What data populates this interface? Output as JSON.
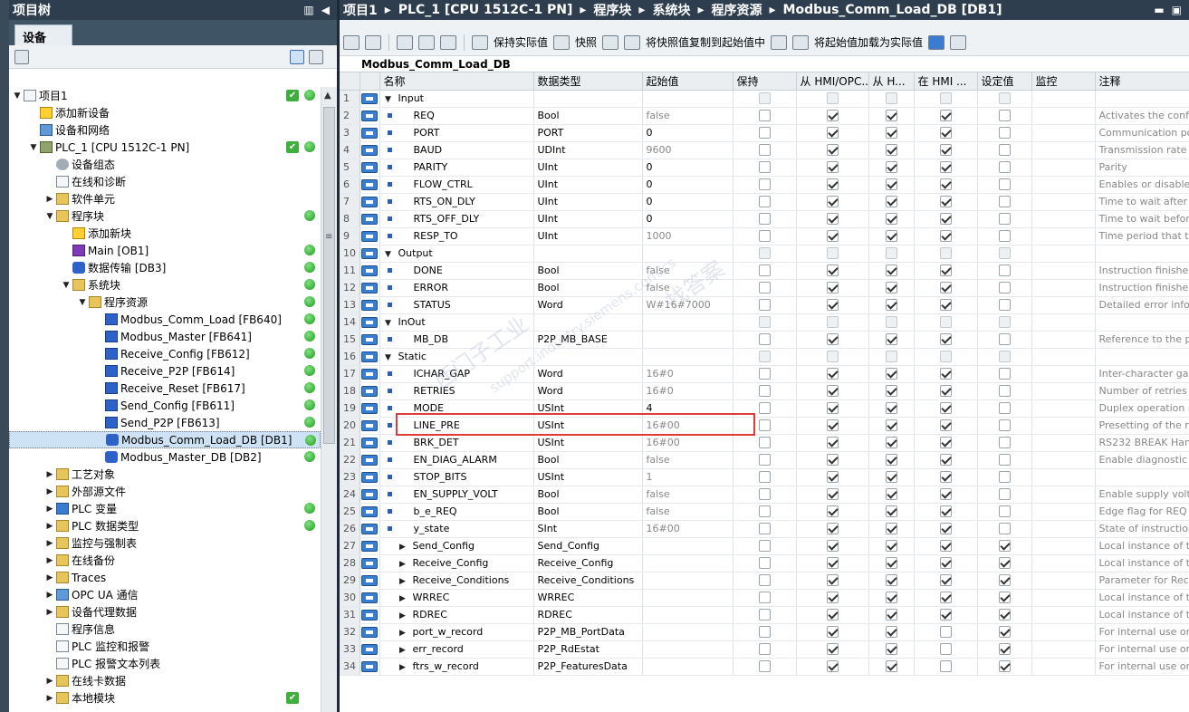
{
  "project_tree": {
    "title": "项目树",
    "tab": "设备",
    "items": [
      {
        "label": "项目1",
        "level": 0,
        "toggle": "▼",
        "icon": "doc",
        "status": "check",
        "dot": true
      },
      {
        "label": "添加新设备",
        "level": 1,
        "toggle": "",
        "icon": "add",
        "status": "",
        "dot": false
      },
      {
        "label": "设备和网络",
        "level": 1,
        "toggle": "",
        "icon": "net",
        "status": "",
        "dot": false
      },
      {
        "label": "PLC_1 [CPU 1512C-1 PN]",
        "level": 1,
        "toggle": "▼",
        "icon": "cpu",
        "status": "check",
        "dot": true
      },
      {
        "label": "设备组态",
        "level": 2,
        "toggle": "",
        "icon": "gear",
        "status": "",
        "dot": false
      },
      {
        "label": "在线和诊断",
        "level": 2,
        "toggle": "",
        "icon": "doc",
        "status": "",
        "dot": false
      },
      {
        "label": "软件单元",
        "level": 2,
        "toggle": "▶",
        "icon": "folder",
        "status": "",
        "dot": false
      },
      {
        "label": "程序块",
        "level": 2,
        "toggle": "▼",
        "icon": "folder",
        "status": "",
        "dot": true
      },
      {
        "label": "添加新块",
        "level": 3,
        "toggle": "",
        "icon": "add",
        "status": "",
        "dot": false
      },
      {
        "label": "Main [OB1]",
        "level": 3,
        "toggle": "",
        "icon": "ob",
        "status": "",
        "dot": true
      },
      {
        "label": "数据传输 [DB3]",
        "level": 3,
        "toggle": "",
        "icon": "db",
        "status": "",
        "dot": true
      },
      {
        "label": "系统块",
        "level": 3,
        "toggle": "▼",
        "icon": "folder",
        "status": "",
        "dot": true
      },
      {
        "label": "程序资源",
        "level": 4,
        "toggle": "▼",
        "icon": "folder",
        "status": "",
        "dot": true
      },
      {
        "label": "Modbus_Comm_Load [FB640]",
        "level": 5,
        "toggle": "",
        "icon": "block",
        "status": "",
        "dot": true
      },
      {
        "label": "Modbus_Master [FB641]",
        "level": 5,
        "toggle": "",
        "icon": "block",
        "status": "",
        "dot": true
      },
      {
        "label": "Receive_Config [FB612]",
        "level": 5,
        "toggle": "",
        "icon": "block",
        "status": "",
        "dot": true
      },
      {
        "label": "Receive_P2P [FB614]",
        "level": 5,
        "toggle": "",
        "icon": "block",
        "status": "",
        "dot": true
      },
      {
        "label": "Receive_Reset [FB617]",
        "level": 5,
        "toggle": "",
        "icon": "block",
        "status": "",
        "dot": true
      },
      {
        "label": "Send_Config [FB611]",
        "level": 5,
        "toggle": "",
        "icon": "block",
        "status": "",
        "dot": true
      },
      {
        "label": "Send_P2P [FB613]",
        "level": 5,
        "toggle": "",
        "icon": "block",
        "status": "",
        "dot": true
      },
      {
        "label": "Modbus_Comm_Load_DB [DB1]",
        "level": 5,
        "toggle": "",
        "icon": "db",
        "status": "",
        "dot": true,
        "selected": true
      },
      {
        "label": "Modbus_Master_DB [DB2]",
        "level": 5,
        "toggle": "",
        "icon": "db",
        "status": "",
        "dot": true
      },
      {
        "label": "工艺对象",
        "level": 2,
        "toggle": "▶",
        "icon": "folder",
        "status": "",
        "dot": false
      },
      {
        "label": "外部源文件",
        "level": 2,
        "toggle": "▶",
        "icon": "folder",
        "status": "",
        "dot": false
      },
      {
        "label": "PLC 变量",
        "level": 2,
        "toggle": "▶",
        "icon": "blue",
        "status": "",
        "dot": true
      },
      {
        "label": "PLC 数据类型",
        "level": 2,
        "toggle": "▶",
        "icon": "folder",
        "status": "",
        "dot": true
      },
      {
        "label": "监控与强制表",
        "level": 2,
        "toggle": "▶",
        "icon": "folder",
        "status": "",
        "dot": false
      },
      {
        "label": "在线备份",
        "level": 2,
        "toggle": "▶",
        "icon": "folder",
        "status": "",
        "dot": false
      },
      {
        "label": "Traces",
        "level": 2,
        "toggle": "▶",
        "icon": "folder",
        "status": "",
        "dot": false
      },
      {
        "label": "OPC UA 通信",
        "level": 2,
        "toggle": "▶",
        "icon": "net",
        "status": "",
        "dot": false
      },
      {
        "label": "设备代理数据",
        "level": 2,
        "toggle": "▶",
        "icon": "folder",
        "status": "",
        "dot": false
      },
      {
        "label": "程序信息",
        "level": 2,
        "toggle": "",
        "icon": "doc",
        "status": "",
        "dot": false
      },
      {
        "label": "PLC 监控和报警",
        "level": 2,
        "toggle": "",
        "icon": "doc",
        "status": "",
        "dot": false
      },
      {
        "label": "PLC 报警文本列表",
        "level": 2,
        "toggle": "",
        "icon": "doc",
        "status": "",
        "dot": false
      },
      {
        "label": "在线卡数据",
        "level": 2,
        "toggle": "▶",
        "icon": "folder",
        "status": "",
        "dot": false
      },
      {
        "label": "本地模块",
        "level": 2,
        "toggle": "▶",
        "icon": "folder",
        "status": "check",
        "dot": false
      }
    ]
  },
  "breadcrumb": {
    "items": [
      "项目1",
      "PLC_1 [CPU 1512C-1 PN]",
      "程序块",
      "系统块",
      "程序资源",
      "Modbus_Comm_Load_DB [DB1]"
    ],
    "sep": "▸"
  },
  "toolbar": {
    "keep_actual": "保持实际值",
    "snapshot": "快照",
    "copy_snapshot": "将快照值复制到起始值中",
    "load_start": "将起始值加载为实际值"
  },
  "db": {
    "title": "Modbus_Comm_Load_DB",
    "headers": [
      "名称",
      "数据类型",
      "起始值",
      "保持",
      "从 HMI/OPC...",
      "从 H...",
      "在 HMI ...",
      "设定值",
      "监控",
      "注释"
    ],
    "rows": [
      {
        "n": "1",
        "name": "Input",
        "type": "",
        "start": "",
        "sec": true,
        "c": [
          0,
          0,
          0,
          0,
          0
        ],
        "comment": ""
      },
      {
        "n": "2",
        "name": "REQ",
        "type": "Bool",
        "start": "false",
        "gray": true,
        "c": [
          0,
          1,
          1,
          1,
          0
        ],
        "comment": "Activates the conf"
      },
      {
        "n": "3",
        "name": "PORT",
        "type": "PORT",
        "start": "0",
        "c": [
          0,
          1,
          1,
          1,
          0
        ],
        "comment": "Communication po"
      },
      {
        "n": "4",
        "name": "BAUD",
        "type": "UDInt",
        "start": "9600",
        "gray": true,
        "c": [
          0,
          1,
          1,
          1,
          0
        ],
        "comment": "Transmission rate"
      },
      {
        "n": "5",
        "name": "PARITY",
        "type": "UInt",
        "start": "0",
        "c": [
          0,
          1,
          1,
          1,
          0
        ],
        "comment": "Parity"
      },
      {
        "n": "6",
        "name": "FLOW_CTRL",
        "type": "UInt",
        "start": "0",
        "c": [
          0,
          1,
          1,
          1,
          0
        ],
        "comment": "Enables or disable"
      },
      {
        "n": "7",
        "name": "RTS_ON_DLY",
        "type": "UInt",
        "start": "0",
        "c": [
          0,
          1,
          1,
          1,
          0
        ],
        "comment": "Time to wait after"
      },
      {
        "n": "8",
        "name": "RTS_OFF_DLY",
        "type": "UInt",
        "start": "0",
        "c": [
          0,
          1,
          1,
          1,
          0
        ],
        "comment": "Time to wait befor"
      },
      {
        "n": "9",
        "name": "RESP_TO",
        "type": "UInt",
        "start": "1000",
        "gray": true,
        "c": [
          0,
          1,
          1,
          1,
          0
        ],
        "comment": "Time period that th"
      },
      {
        "n": "10",
        "name": "Output",
        "type": "",
        "start": "",
        "sec": true,
        "c": [
          0,
          0,
          0,
          0,
          0
        ],
        "comment": ""
      },
      {
        "n": "11",
        "name": "DONE",
        "type": "Bool",
        "start": "false",
        "gray": true,
        "c": [
          0,
          1,
          1,
          1,
          0
        ],
        "comment": "Instruction finishe"
      },
      {
        "n": "12",
        "name": "ERROR",
        "type": "Bool",
        "start": "false",
        "gray": true,
        "c": [
          0,
          1,
          1,
          1,
          0
        ],
        "comment": "Instruction finishe"
      },
      {
        "n": "13",
        "name": "STATUS",
        "type": "Word",
        "start": "W#16#7000",
        "gray": true,
        "c": [
          0,
          1,
          1,
          1,
          0
        ],
        "comment": "Detailed error info"
      },
      {
        "n": "14",
        "name": "InOut",
        "type": "",
        "start": "",
        "sec": true,
        "c": [
          0,
          0,
          0,
          0,
          0
        ],
        "comment": ""
      },
      {
        "n": "15",
        "name": "MB_DB",
        "type": "P2P_MB_BASE",
        "start": "",
        "c": [
          0,
          1,
          1,
          1,
          0
        ],
        "comment": "Reference to the p"
      },
      {
        "n": "16",
        "name": "Static",
        "type": "",
        "start": "",
        "sec": true,
        "c": [
          0,
          0,
          0,
          0,
          0
        ],
        "comment": ""
      },
      {
        "n": "17",
        "name": "ICHAR_GAP",
        "type": "Word",
        "start": "16#0",
        "gray": true,
        "c": [
          0,
          1,
          1,
          1,
          0
        ],
        "comment": "Inter-character ga"
      },
      {
        "n": "18",
        "name": "RETRIES",
        "type": "Word",
        "start": "16#0",
        "gray": true,
        "c": [
          0,
          1,
          1,
          1,
          0
        ],
        "comment": "Number of retries"
      },
      {
        "n": "19",
        "name": "MODE",
        "type": "USInt",
        "start": "4",
        "c": [
          0,
          1,
          1,
          1,
          0
        ],
        "comment": "Duplex operation m"
      },
      {
        "n": "20",
        "name": "LINE_PRE",
        "type": "USInt",
        "start": "16#00",
        "gray": true,
        "c": [
          0,
          1,
          1,
          1,
          0
        ],
        "comment": "Presetting of the re"
      },
      {
        "n": "21",
        "name": "BRK_DET",
        "type": "USInt",
        "start": "16#00",
        "gray": true,
        "c": [
          0,
          1,
          1,
          1,
          0
        ],
        "comment": "RS232 BREAK Hand"
      },
      {
        "n": "22",
        "name": "EN_DIAG_ALARM",
        "type": "Bool",
        "start": "false",
        "gray": true,
        "c": [
          0,
          1,
          1,
          1,
          0
        ],
        "comment": "Enable diagnostic"
      },
      {
        "n": "23",
        "name": "STOP_BITS",
        "type": "USInt",
        "start": "1",
        "gray": true,
        "c": [
          0,
          1,
          1,
          1,
          0
        ],
        "comment": ""
      },
      {
        "n": "24",
        "name": "EN_SUPPLY_VOLT",
        "type": "Bool",
        "start": "false",
        "gray": true,
        "c": [
          0,
          1,
          1,
          1,
          0
        ],
        "comment": "Enable supply volt"
      },
      {
        "n": "25",
        "name": "b_e_REQ",
        "type": "Bool",
        "start": "false",
        "gray": true,
        "c": [
          0,
          1,
          1,
          1,
          0
        ],
        "comment": "Edge flag for REQ"
      },
      {
        "n": "26",
        "name": "y_state",
        "type": "SInt",
        "start": "16#00",
        "gray": true,
        "c": [
          0,
          1,
          1,
          1,
          0
        ],
        "comment": "State of instruction"
      },
      {
        "n": "27",
        "name": "Send_Config",
        "type": "Send_Config",
        "start": "",
        "exp": true,
        "c": [
          0,
          1,
          1,
          1,
          1
        ],
        "comment": "Local instance of t"
      },
      {
        "n": "28",
        "name": "Receive_Config",
        "type": "Receive_Config",
        "start": "",
        "exp": true,
        "c": [
          0,
          1,
          1,
          1,
          1
        ],
        "comment": "Local instance of t"
      },
      {
        "n": "29",
        "name": "Receive_Conditions",
        "type": "Receive_Conditions",
        "start": "",
        "exp": true,
        "c": [
          0,
          1,
          1,
          1,
          1
        ],
        "comment": "Parameter for Rece"
      },
      {
        "n": "30",
        "name": "WRREC",
        "type": "WRREC",
        "start": "",
        "exp": true,
        "c": [
          0,
          1,
          1,
          1,
          1
        ],
        "comment": "Local instance of t"
      },
      {
        "n": "31",
        "name": "RDREC",
        "type": "RDREC",
        "start": "",
        "exp": true,
        "c": [
          0,
          1,
          1,
          1,
          1
        ],
        "comment": "Local instance of t"
      },
      {
        "n": "32",
        "name": "port_w_record",
        "type": "P2P_MB_PortData",
        "start": "",
        "exp": true,
        "c": [
          0,
          1,
          1,
          0,
          1
        ],
        "comment": "For internal use or"
      },
      {
        "n": "33",
        "name": "err_record",
        "type": "P2P_RdEstat",
        "start": "",
        "exp": true,
        "c": [
          0,
          1,
          1,
          0,
          1
        ],
        "comment": "For internal use or"
      },
      {
        "n": "34",
        "name": "ftrs_w_record",
        "type": "P2P_FeaturesData",
        "start": "",
        "exp": true,
        "c": [
          0,
          1,
          1,
          0,
          1
        ],
        "comment": "For internal use or"
      }
    ]
  },
  "watermark": {
    "a": "西门子工业",
    "b": "support.industry.siemens.com/cs",
    "c": "找答案"
  },
  "colors": {
    "highlight": "#e03b3b",
    "status_ok": "#3fae3f",
    "title_bar": "#2e3e4e"
  }
}
